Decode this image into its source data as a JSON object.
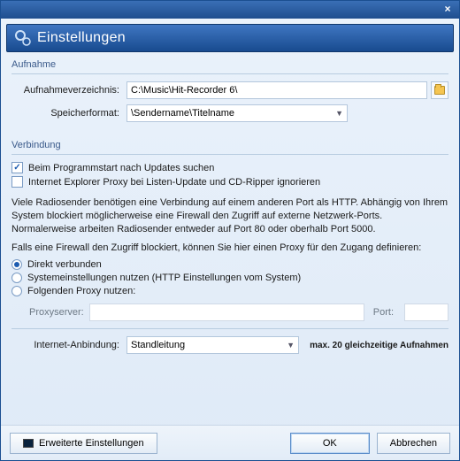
{
  "window": {
    "title": "Einstellungen"
  },
  "sections": {
    "aufnahme": {
      "label": "Aufnahme",
      "dir_label": "Aufnahmeverzeichnis:",
      "dir_value": "C:\\Music\\Hit-Recorder 6\\",
      "format_label": "Speicherformat:",
      "format_value": "\\Sendername\\Titelname"
    },
    "verbindung": {
      "label": "Verbindung",
      "chk_updates": "Beim Programmstart nach Updates suchen",
      "chk_ieproxy": "Internet Explorer Proxy bei Listen-Update und CD-Ripper ignorieren",
      "info1": "Viele Radiosender benötigen eine Verbindung auf einem anderen Port als HTTP. Abhängig von Ihrem System blockiert möglicherweise eine Firewall den Zugriff auf externe Netzwerk-Ports. Normalerweise arbeiten Radiosender entweder auf Port 80 oder oberhalb Port 5000.",
      "info2": "Falls eine Firewall den Zugriff blockiert, können Sie hier einen Proxy für den Zugang definieren:",
      "radio_direct": "Direkt verbunden",
      "radio_system": "Systemeinstellungen nutzen (HTTP Einstellungen vom System)",
      "radio_custom": "Folgenden Proxy nutzen:",
      "proxy_server_label": "Proxyserver:",
      "proxy_port_label": "Port:",
      "binding_label": "Internet-Anbindung:",
      "binding_value": "Standleitung",
      "max_text": "max. 20 gleichzeitige Aufnahmen"
    }
  },
  "footer": {
    "advanced": "Erweiterte Einstellungen",
    "ok": "OK",
    "cancel": "Abbrechen"
  }
}
